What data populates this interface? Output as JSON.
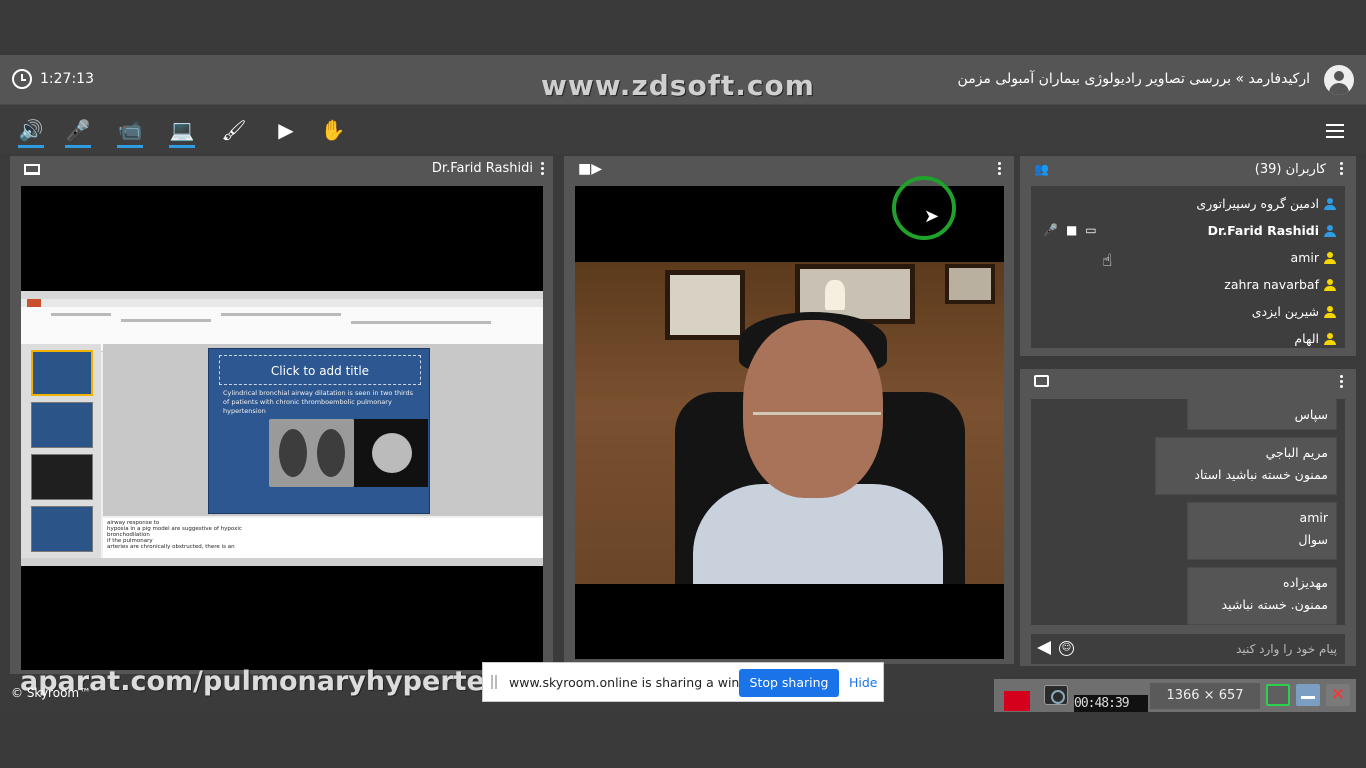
{
  "header": {
    "timer": "1:27:13",
    "watermark": "www.zdsoft.com",
    "room_title": "ارکیدفارمد » بررسی تصاویر رادیولوژی بیماران آمبولی مزمن"
  },
  "toolbar": {
    "items": [
      "speaker-icon",
      "microphone-icon",
      "camera-icon",
      "screen-share-icon",
      "brush-icon",
      "play-media-icon",
      "raise-hand-icon"
    ],
    "glyphs": [
      "🔊",
      "🎤",
      "📹",
      "💻",
      "🖌",
      "▶",
      "✋"
    ],
    "active_color": "#2f9be0"
  },
  "screen_panel": {
    "title": "Dr.Farid Rashidi",
    "slide": {
      "title": "Click to add title",
      "bullet": "Cylindrical bronchial airway dilatation is seen in two thirds of patients with chronic thromboembolic pulmonary hypertension",
      "notes": "airway response to\nhypoxia in a pig model are suggestive of hypoxic\nbronchodilation\nif the pulmonary\narteries are chronically obstructed, there is an"
    }
  },
  "users_panel": {
    "title": "کاربران (39)",
    "users": [
      {
        "name": "ادمین گروه رسپیراتوری",
        "role": "admin",
        "color": "#2f9be0",
        "bold": false
      },
      {
        "name": "Dr.Farid Rashidi",
        "role": "presenter",
        "color": "#2f9be0",
        "bold": true
      },
      {
        "name": "amir",
        "role": "user",
        "color": "#f5d800",
        "bold": false
      },
      {
        "name": "zahra navarbaf",
        "role": "user",
        "color": "#f5d800",
        "bold": false
      },
      {
        "name": "شیرین ایزدی",
        "role": "user",
        "color": "#f5d800",
        "bold": false
      },
      {
        "name": "الهام",
        "role": "user",
        "color": "#f5d800",
        "bold": false
      }
    ]
  },
  "chat_panel": {
    "messages": [
      {
        "sender": "",
        "text": "سپاس"
      },
      {
        "sender": "مریم الباجي",
        "text": "ممنون خسته نباشید استاد"
      },
      {
        "sender": "amir",
        "text": "سوال"
      },
      {
        "sender": "مهدیزاده",
        "text": "ممنون. خسته نباشید"
      }
    ],
    "input_placeholder": "پیام خود را وارد کنید"
  },
  "footer": {
    "brand": "© Skyroom™",
    "aparat_watermark": "aparat.com/pulmonaryhypertension"
  },
  "share_bar": {
    "message": "www.skyroom.online is sharing a window.",
    "stop_label": "Stop sharing",
    "hide_label": "Hide"
  },
  "recorder": {
    "time": "00:48:39",
    "size": "1366 × 657"
  }
}
